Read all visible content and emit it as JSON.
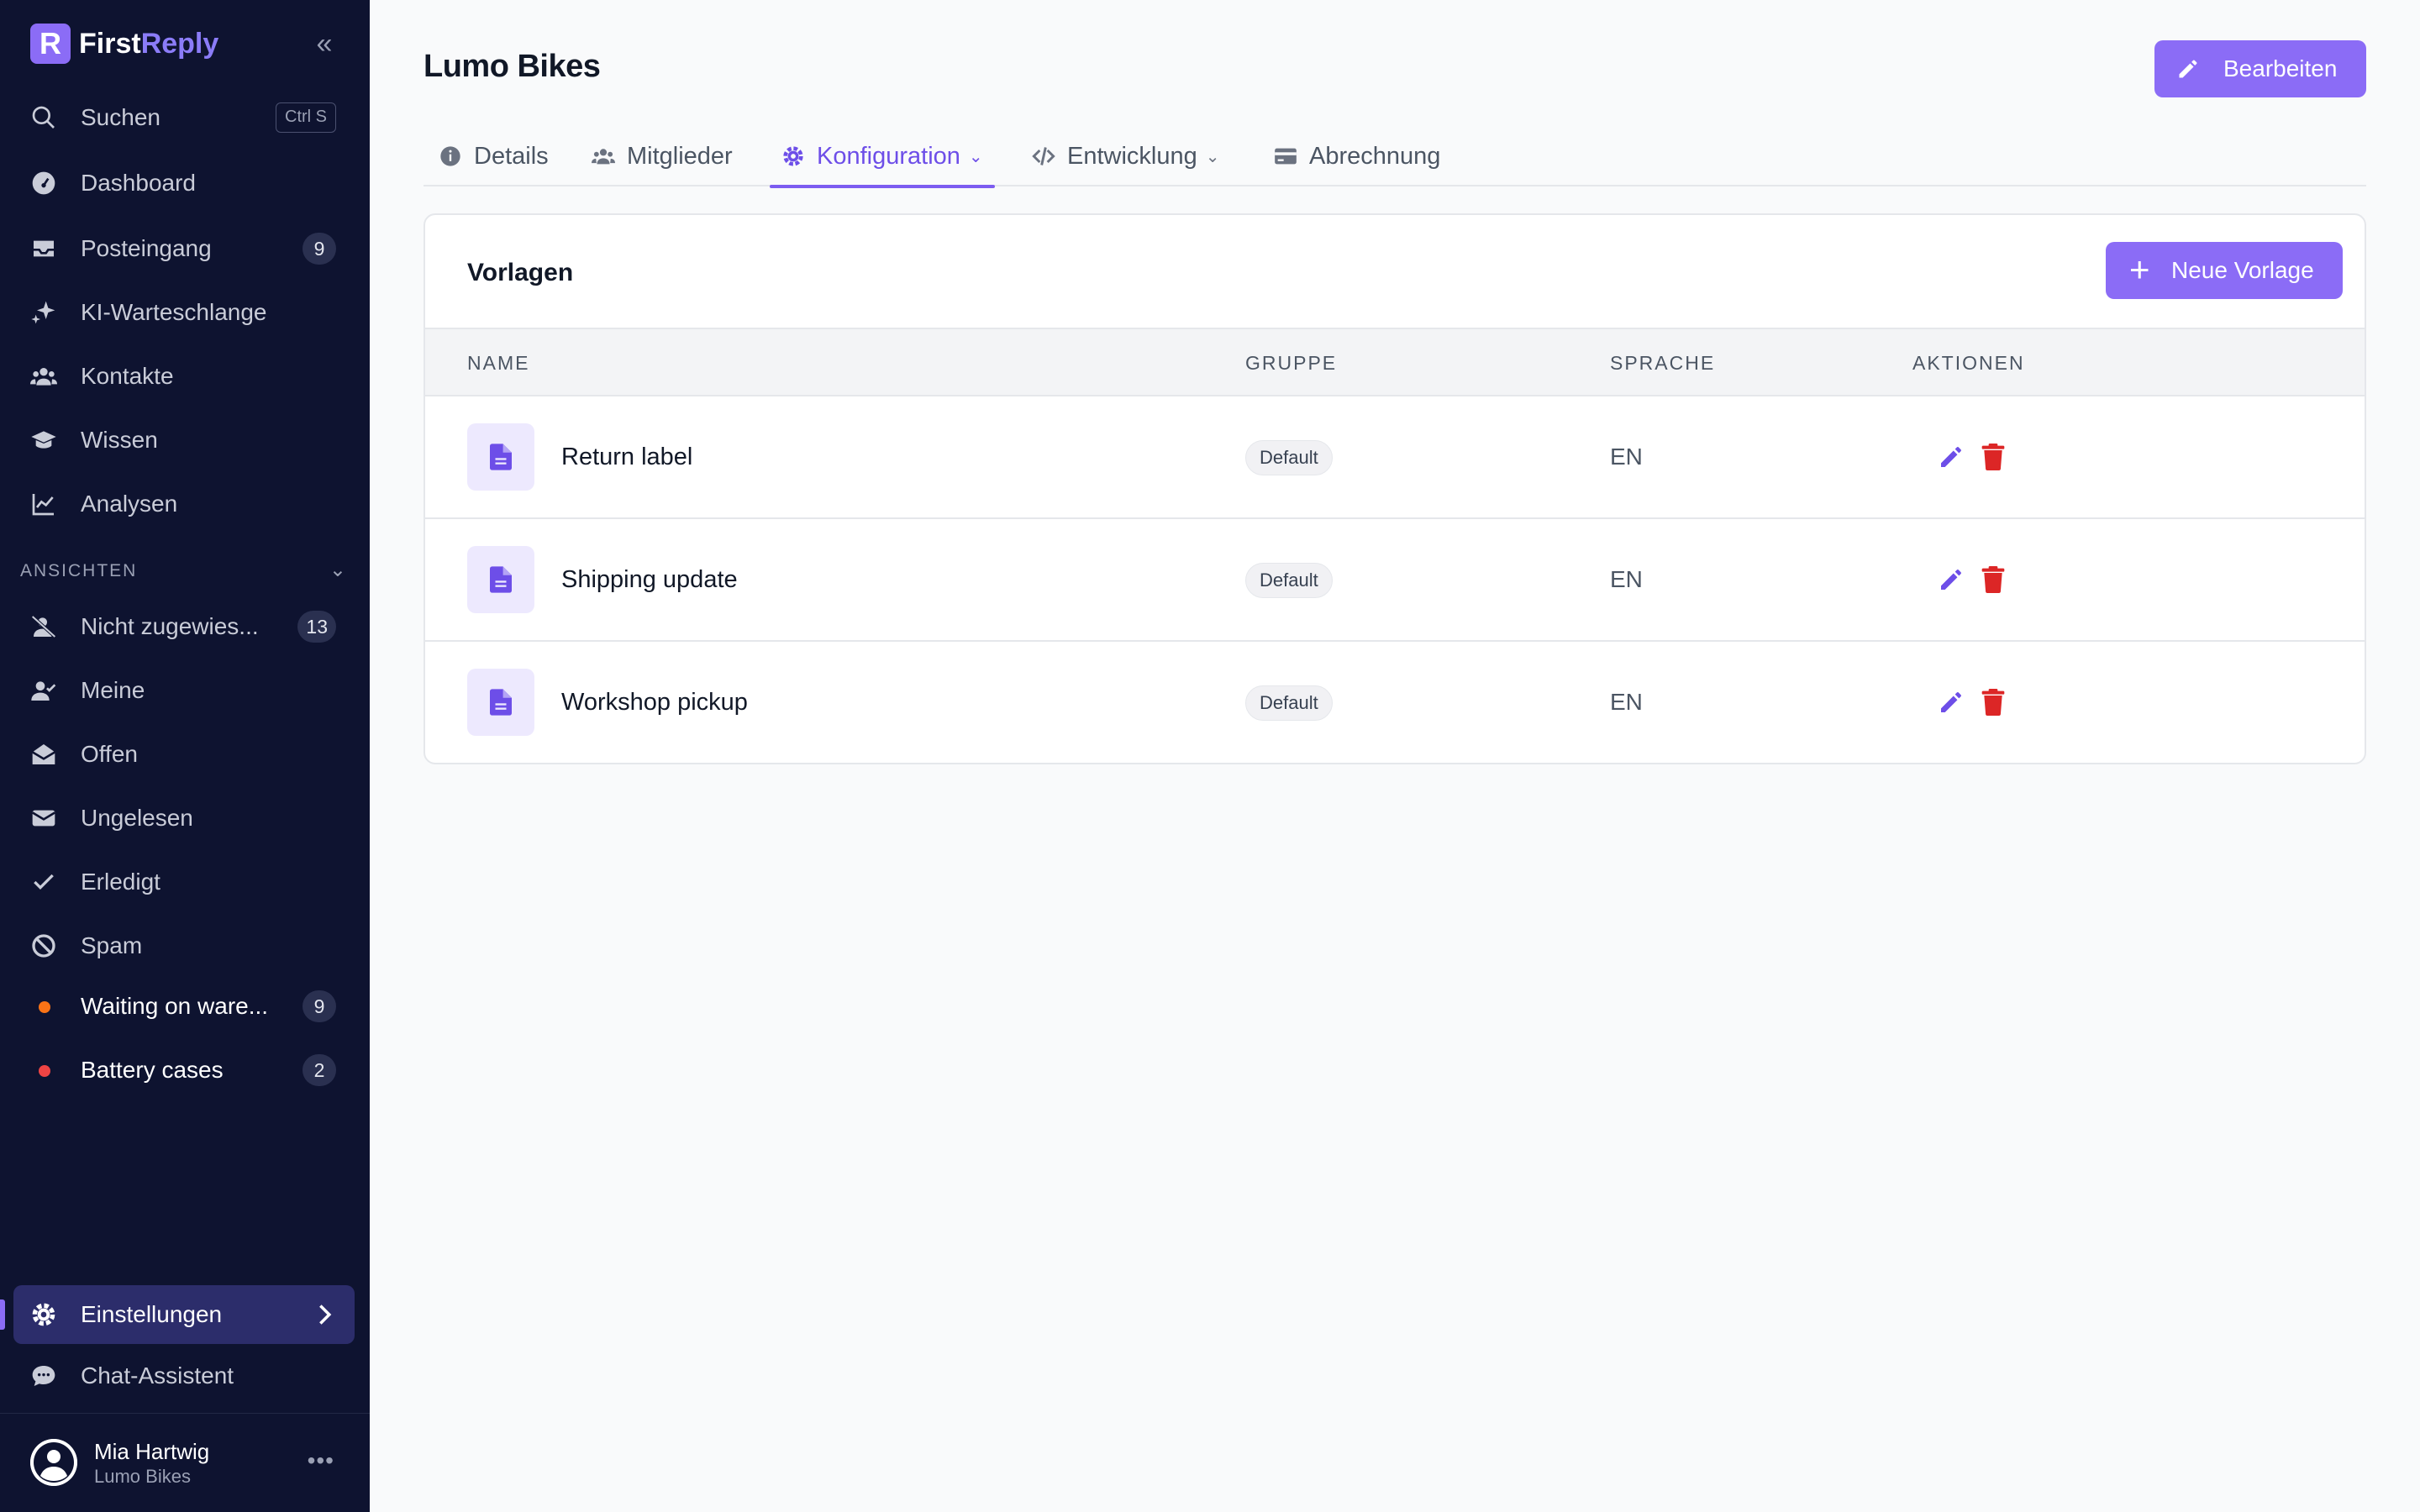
{
  "brand": {
    "first": "First",
    "second": "Reply",
    "logo_letter": "R"
  },
  "sidebar": {
    "search": {
      "label": "Suchen",
      "shortcut": "Ctrl S"
    },
    "items": [
      {
        "label": "Dashboard",
        "icon": "dashboard-icon"
      },
      {
        "label": "Posteingang",
        "icon": "inbox-icon",
        "count": "9"
      },
      {
        "label": "KI-Warteschlange",
        "icon": "sparkles-icon"
      },
      {
        "label": "Kontakte",
        "icon": "users-icon"
      },
      {
        "label": "Wissen",
        "icon": "graduation-cap-icon"
      },
      {
        "label": "Analysen",
        "icon": "chart-line-icon"
      }
    ],
    "views_heading": "ANSICHTEN",
    "views": [
      {
        "label": "Nicht zugewies...",
        "icon": "user-slash-icon",
        "count": "13"
      },
      {
        "label": "Meine",
        "icon": "user-check-icon"
      },
      {
        "label": "Offen",
        "icon": "envelope-open-icon"
      },
      {
        "label": "Ungelesen",
        "icon": "envelope-icon"
      },
      {
        "label": "Erledigt",
        "icon": "check-icon"
      },
      {
        "label": "Spam",
        "icon": "ban-icon"
      },
      {
        "label": "Waiting on ware...",
        "icon": "dot-icon",
        "color": "#f97316",
        "count": "9"
      },
      {
        "label": "Battery cases",
        "icon": "dot-icon",
        "color": "#ef4444",
        "count": "2"
      }
    ],
    "settings_label": "Einstellungen",
    "chat_label": "Chat-Assistent",
    "user": {
      "name": "Mia Hartwig",
      "org": "Lumo Bikes"
    }
  },
  "header": {
    "title": "Lumo Bikes",
    "edit_label": "Bearbeiten"
  },
  "tabs": [
    {
      "label": "Details",
      "icon": "info-circle-icon"
    },
    {
      "label": "Mitglieder",
      "icon": "users-icon"
    },
    {
      "label": "Konfiguration",
      "icon": "gear-icon",
      "active": true
    },
    {
      "label": "Entwicklung",
      "icon": "code-icon"
    },
    {
      "label": "Abrechnung",
      "icon": "credit-card-icon"
    }
  ],
  "templates": {
    "title": "Vorlagen",
    "new_label": "Neue Vorlage",
    "columns": [
      "NAME",
      "GRUPPE",
      "SPRACHE",
      "AKTIONEN"
    ],
    "rows": [
      {
        "name": "Return label",
        "group": "Default",
        "language": "EN"
      },
      {
        "name": "Shipping update",
        "group": "Default",
        "language": "EN"
      },
      {
        "name": "Workshop pickup",
        "group": "Default",
        "language": "EN"
      }
    ]
  },
  "colors": {
    "accent": "#8b6cf6",
    "sidebar_bg": "#0e1330",
    "danger": "#dc2626"
  }
}
